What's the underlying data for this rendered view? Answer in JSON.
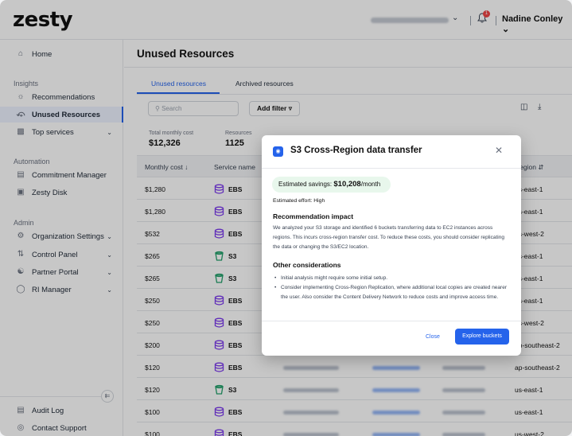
{
  "app": {
    "logo": "zesty"
  },
  "header": {
    "notification_count": "1",
    "user_name": "Nadine Conley"
  },
  "sidebar": {
    "home": "Home",
    "insights_heading": "Insights",
    "insights_items": [
      {
        "label": "Recommendations",
        "icon": "lightbulb-icon"
      },
      {
        "label": "Unused Resources",
        "icon": "unused-icon",
        "active": true
      },
      {
        "label": "Top services",
        "icon": "bar-chart-icon",
        "chevron": true
      }
    ],
    "automation_heading": "Automation",
    "automation_items": [
      {
        "label": "Commitment Manager",
        "icon": "chart-icon"
      },
      {
        "label": "Zesty Disk",
        "icon": "disk-icon"
      }
    ],
    "admin_heading": "Admin",
    "admin_items": [
      {
        "label": "Organization Settings",
        "icon": "gear-icon",
        "chevron": true
      },
      {
        "label": "Control Panel",
        "icon": "sliders-icon",
        "chevron": true
      },
      {
        "label": "Partner Portal",
        "icon": "handshake-icon",
        "chevron": true
      },
      {
        "label": "RI Manager",
        "icon": "shield-icon",
        "chevron": true
      }
    ],
    "footer_items": [
      {
        "label": "Audit Log",
        "icon": "document-icon"
      },
      {
        "label": "Contact Support",
        "icon": "support-icon"
      }
    ]
  },
  "main": {
    "title": "Unused Resources",
    "tabs": [
      "Unused resources",
      "Archived resources"
    ],
    "search_placeholder": "Search",
    "add_filter": "Add filter",
    "stats": [
      {
        "label": "Total monthly cost",
        "value": "$12,326"
      },
      {
        "label": "Resources",
        "value": "1125"
      }
    ],
    "columns": {
      "cost": "Monthly cost",
      "service": "Service name",
      "region": "Region"
    },
    "rows": [
      {
        "cost": "$1,280",
        "service": "EBS",
        "region": "us-east-1"
      },
      {
        "cost": "$1,280",
        "service": "EBS",
        "region": "us-east-1"
      },
      {
        "cost": "$532",
        "service": "EBS",
        "region": "us-west-2"
      },
      {
        "cost": "$265",
        "service": "S3",
        "region": "us-east-1"
      },
      {
        "cost": "$265",
        "service": "S3",
        "region": "us-east-1"
      },
      {
        "cost": "$250",
        "service": "EBS",
        "region": "us-east-1"
      },
      {
        "cost": "$250",
        "service": "EBS",
        "region": "us-west-2"
      },
      {
        "cost": "$200",
        "service": "EBS",
        "region": "ap-southeast-2"
      },
      {
        "cost": "$120",
        "service": "EBS",
        "region": "ap-southeast-2"
      },
      {
        "cost": "$120",
        "service": "S3",
        "region": "us-east-1"
      },
      {
        "cost": "$100",
        "service": "EBS",
        "region": "us-east-1"
      },
      {
        "cost": "$100",
        "service": "EBS",
        "region": "us-west-2"
      }
    ]
  },
  "modal": {
    "title": "S3 Cross-Region data transfer",
    "savings_label": "Estimated savings:",
    "savings_value": "$10,208",
    "savings_unit": "/month",
    "effort": "Estimated effort:  High",
    "impact_heading": "Recommendation impact",
    "impact_text": "We analyzed your S3 storage and identified 6 buckets transferring data to EC2 instances across regions. This incurs cross-region transfer cost. To reduce these costs, you should consider replicating the data or changing the S3/EC2 location.",
    "other_heading": "Other considerations",
    "bullets": [
      "Initial analysis might require some initial setup.",
      "Consider implementing Cross-Region Replication, where additional local copies are created nearer the user. Also consider the Content Delivery Network to reduce costs and improve access time."
    ],
    "cancel": "Close",
    "primary": "Explore buckets"
  }
}
